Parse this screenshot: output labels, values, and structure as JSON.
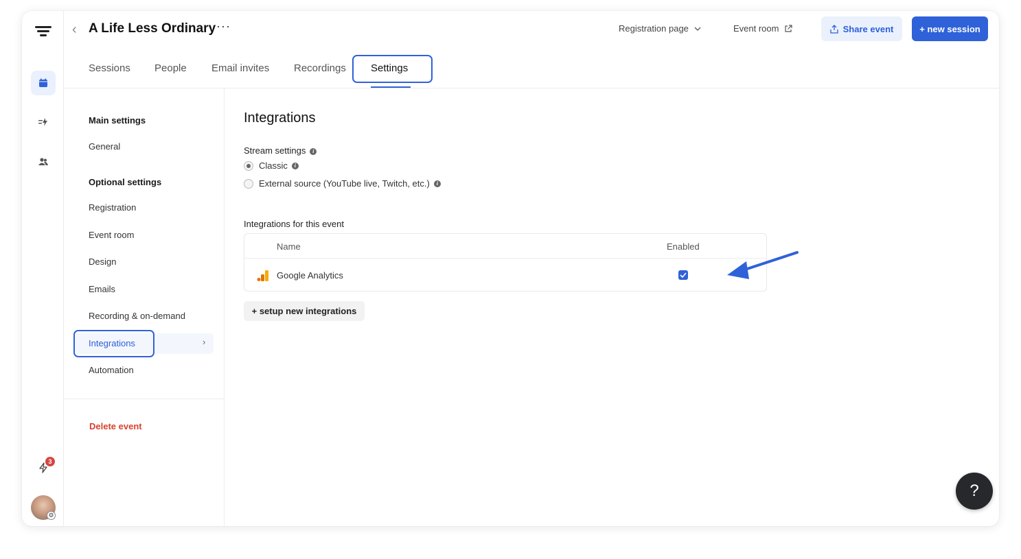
{
  "header": {
    "title": "A Life Less Ordinary",
    "registration_page": "Registration page",
    "event_room": "Event room",
    "share_event": "Share event",
    "new_session": "+ new session"
  },
  "tabs": [
    {
      "label": "Sessions"
    },
    {
      "label": "People"
    },
    {
      "label": "Email invites"
    },
    {
      "label": "Recordings"
    },
    {
      "label": "Settings",
      "active": true
    }
  ],
  "rail": {
    "icons": [
      "logo-icon",
      "calendar-icon",
      "lightning-list-icon",
      "people-icon",
      "lightning-icon"
    ],
    "notifications_count": "3"
  },
  "sidebar": {
    "main_heading": "Main settings",
    "general": "General",
    "optional_heading": "Optional settings",
    "items": [
      "Registration",
      "Event room",
      "Design",
      "Emails",
      "Recording & on-demand",
      "Integrations",
      "Automation"
    ],
    "active_item": "Integrations",
    "delete": "Delete event"
  },
  "main": {
    "heading": "Integrations",
    "stream_settings_label": "Stream settings",
    "stream_options": [
      "Classic",
      "External source (YouTube live, Twitch, etc.)"
    ],
    "stream_selected": "Classic",
    "integrations_label": "Integrations for this event",
    "table": {
      "columns": [
        "Name",
        "Enabled"
      ],
      "rows": [
        {
          "name": "Google Analytics",
          "enabled": true
        }
      ]
    },
    "setup_button": "+ setup new integrations"
  },
  "help": "?",
  "colors": {
    "accent": "#2f62d8",
    "danger": "#d9412f"
  }
}
